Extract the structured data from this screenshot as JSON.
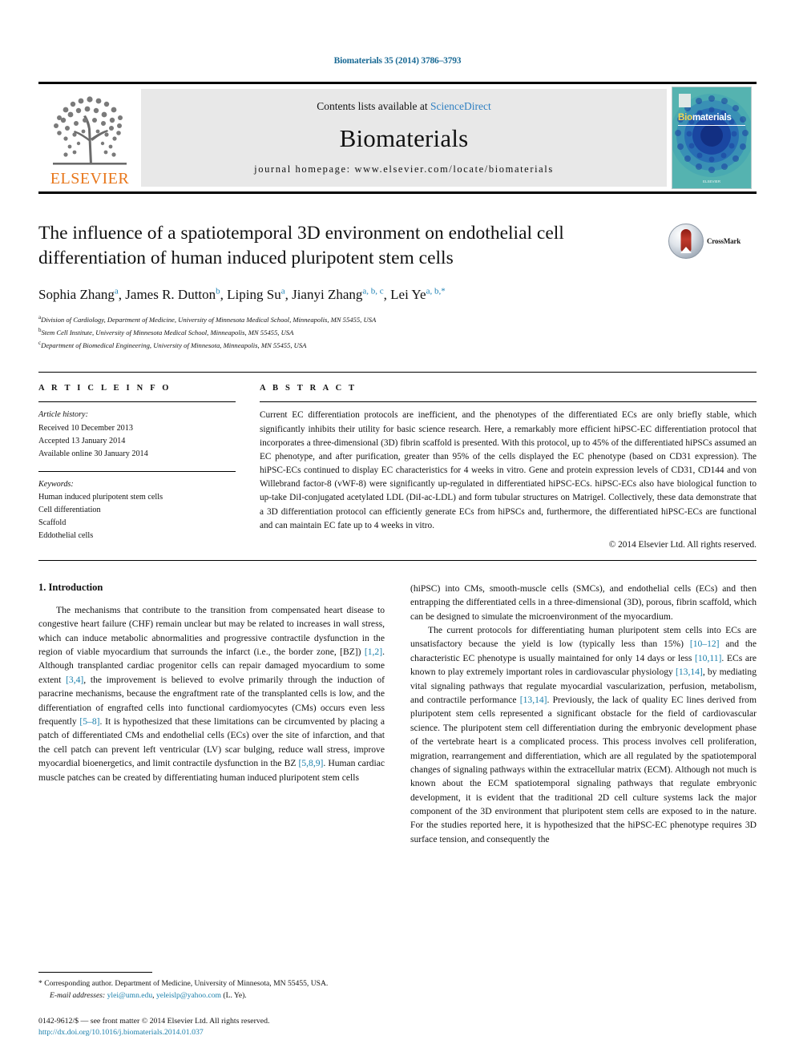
{
  "running_head": "Biomaterials 35 (2014) 3786–3793",
  "masthead": {
    "publisher_name": "ELSEVIER",
    "contents_prefix": "Contents lists available at",
    "contents_link": "ScienceDirect",
    "journal_name": "Biomaterials",
    "homepage_line": "journal homepage: www.elsevier.com/locate/biomaterials",
    "cover": {
      "title_prefix": "Bio",
      "title_rest": "materials",
      "footer": "ELSEVIER"
    }
  },
  "article": {
    "title": "The influence of a spatiotemporal 3D environment on endothelial cell differentiation of human induced pluripotent stem cells",
    "crossmark_label": "CrossMark",
    "authors": [
      {
        "name": "Sophia Zhang",
        "marks": "a",
        "sep": ", "
      },
      {
        "name": "James R. Dutton",
        "marks": "b",
        "sep": ", "
      },
      {
        "name": "Liping Su",
        "marks": "a",
        "sep": ", "
      },
      {
        "name": "Jianyi Zhang",
        "marks": "a, b, c",
        "sep": ", "
      },
      {
        "name": "Lei Ye",
        "marks": "a, b,*",
        "sep": ""
      }
    ],
    "affiliations": [
      {
        "mark": "a",
        "text": "Division of Cardiology, Department of Medicine, University of Minnesota Medical School, Minneapolis, MN 55455, USA"
      },
      {
        "mark": "b",
        "text": "Stem Cell Institute, University of Minnesota Medical School, Minneapolis, MN 55455, USA"
      },
      {
        "mark": "c",
        "text": "Department of Biomedical Engineering, University of Minnesota, Minneapolis, MN 55455, USA"
      }
    ]
  },
  "article_info": {
    "heading": "A R T I C L E  I N F O",
    "history_label": "Article history:",
    "history": [
      "Received 10 December 2013",
      "Accepted 13 January 2014",
      "Available online 30 January 2014"
    ],
    "keywords_label": "Keywords:",
    "keywords": [
      "Human induced pluripotent stem cells",
      "Cell differentiation",
      "Scaffold",
      "Eddothelial cells"
    ]
  },
  "abstract": {
    "heading": "A B S T R A C T",
    "text": "Current EC differentiation protocols are inefficient, and the phenotypes of the differentiated ECs are only briefly stable, which significantly inhibits their utility for basic science research. Here, a remarkably more efficient hiPSC-EC differentiation protocol that incorporates a three-dimensional (3D) fibrin scaffold is presented. With this protocol, up to 45% of the differentiated hiPSCs assumed an EC phenotype, and after purification, greater than 95% of the cells displayed the EC phenotype (based on CD31 expression). The hiPSC-ECs continued to display EC characteristics for 4 weeks in vitro. Gene and protein expression levels of CD31, CD144 and von Willebrand factor-8 (vWF-8) were significantly up-regulated in differentiated hiPSC-ECs. hiPSC-ECs also have biological function to up-take DiI-conjugated acetylated LDL (DiI-ac-LDL) and form tubular structures on Matrigel. Collectively, these data demonstrate that a 3D differentiation protocol can efficiently generate ECs from hiPSCs and, furthermore, the differentiated hiPSC-ECs are functional and can maintain EC fate up to 4 weeks in vitro.",
    "copyright": "© 2014 Elsevier Ltd. All rights reserved."
  },
  "body": {
    "section_number_title": "1. Introduction",
    "left_paragraph_1_a": "The mechanisms that contribute to the transition from compensated heart disease to congestive heart failure (CHF) remain unclear but may be related to increases in wall stress, which can induce metabolic abnormalities and progressive contractile dysfunction in the region of viable myocardium that surrounds the infarct (i.e., the border zone, [BZ]) ",
    "ref_1_2": "[1,2]",
    "left_paragraph_1_b": ". Although transplanted cardiac progenitor cells can repair damaged myocardium to some extent ",
    "ref_3_4": "[3,4]",
    "left_paragraph_1_c": ", the improvement is believed to evolve primarily through the induction of paracrine mechanisms, because the engraftment rate of the transplanted cells is low, and the differentiation of engrafted cells into functional cardiomyocytes (CMs) occurs even less frequently ",
    "ref_5_8": "[5–8]",
    "left_paragraph_1_d": ". It is hypothesized that these limitations can be circumvented by placing a patch of differentiated CMs and endothelial cells (ECs) over the site of infarction, and that the cell patch can prevent left ventricular (LV) scar bulging, reduce wall stress, improve myocardial bioenergetics, and limit contractile dysfunction in the BZ ",
    "ref_5_8_9": "[5,8,9]",
    "left_paragraph_1_e": ". Human cardiac muscle patches can be created by differentiating human induced pluripotent stem cells",
    "right_paragraph_1_cont": "(hiPSC) into CMs, smooth-muscle cells (SMCs), and endothelial cells (ECs) and then entrapping the differentiated cells in a three-dimensional (3D), porous, fibrin scaffold, which can be designed to simulate the microenvironment of the myocardium.",
    "right_paragraph_2_a": "The current protocols for differentiating human pluripotent stem cells into ECs are unsatisfactory because the yield is low (typically less than 15%) ",
    "ref_10_12": "[10–12]",
    "right_paragraph_2_b": " and the characteristic EC phenotype is usually maintained for only 14 days or less ",
    "ref_10_11": "[10,11]",
    "right_paragraph_2_c": ". ECs are known to play extremely important roles in cardiovascular physiology ",
    "ref_13_14": "[13,14]",
    "right_paragraph_2_d": ", by mediating vital signaling pathways that regulate myocardial vascularization, perfusion, metabolism, and contractile performance ",
    "ref_13_14_b": "[13,14]",
    "right_paragraph_2_e": ". Previously, the lack of quality EC lines derived from pluripotent stem cells represented a significant obstacle for the field of cardiovascular science. The pluripotent stem cell differentiation during the embryonic development phase of the vertebrate heart is a complicated process. This process involves cell proliferation, migration, rearrangement and differentiation, which are all regulated by the spatiotemporal changes of signaling pathways within the extracellular matrix (ECM). Although not much is known about the ECM spatiotemporal signaling pathways that regulate embryonic development, it is evident that the traditional 2D cell culture systems lack the major component of the 3D environment that pluripotent stem cells are exposed to in the nature. For the studies reported here, it is hypothesized that the hiPSC-EC phenotype requires 3D surface tension, and consequently the"
  },
  "footnote": {
    "corresponding": "* Corresponding author. Department of Medicine, University of Minnesota, MN 55455, USA.",
    "email_label": "E-mail addresses:",
    "email_1": "ylei@umn.edu",
    "email_sep": ", ",
    "email_2": "yeleislp@yahoo.com",
    "email_suffix": " (L. Ye).",
    "issn_line": "0142-9612/$ — see front matter © 2014 Elsevier Ltd. All rights reserved.",
    "doi": "http://dx.doi.org/10.1016/j.biomaterials.2014.01.037"
  },
  "colors": {
    "link": "#1a7fab",
    "running_head": "#1a6a95",
    "elsevier_orange": "#E8761A",
    "sciencedirect": "#2f7fc1"
  }
}
